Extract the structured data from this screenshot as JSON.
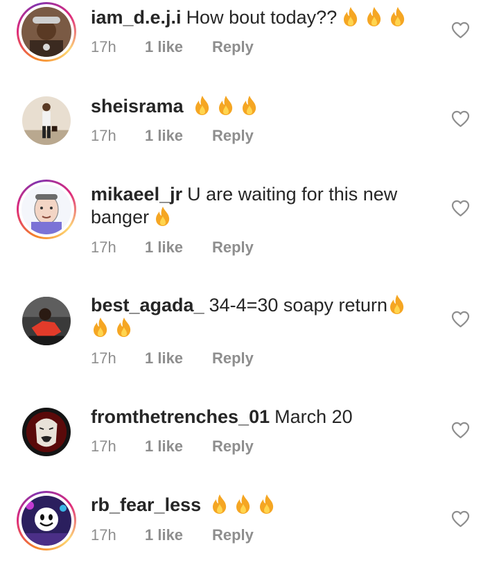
{
  "comments": [
    {
      "username": "iam_d.e.j.i",
      "text": "How bout today??",
      "fire_after_text": 3,
      "fire_line2": 0,
      "time": "17h",
      "likes": "1 like",
      "reply": "Reply",
      "has_story": true,
      "avatar_icon": "avatar-person-hat"
    },
    {
      "username": "sheisrama",
      "text": "",
      "fire_after_text": 3,
      "fire_line2": 0,
      "time": "17h",
      "likes": "1 like",
      "reply": "Reply",
      "has_story": false,
      "avatar_icon": "avatar-person-standing"
    },
    {
      "username": "mikaeel_jr",
      "text": "U are waiting for this new",
      "text_line2": "banger",
      "fire_after_text": 0,
      "fire_line2": 1,
      "time": "17h",
      "likes": "1 like",
      "reply": "Reply",
      "has_story": true,
      "avatar_icon": "avatar-cartoon-face"
    },
    {
      "username": "best_agada_",
      "text": "34-4=30 soapy return",
      "fire_after_text": 1,
      "fire_line2": 2,
      "time": "17h",
      "likes": "1 like",
      "reply": "Reply",
      "has_story": false,
      "avatar_icon": "avatar-person-red"
    },
    {
      "username": "fromthetrenches_01",
      "text": "March 20",
      "fire_after_text": 0,
      "fire_line2": 0,
      "time": "17h",
      "likes": "1 like",
      "reply": "Reply",
      "has_story": false,
      "avatar_icon": "avatar-mask"
    },
    {
      "username": "rb_fear_less",
      "text": "",
      "fire_after_text": 3,
      "fire_line2": 0,
      "time": "17h",
      "likes": "1 like",
      "reply": "Reply",
      "has_story": true,
      "avatar_icon": "avatar-marshmello"
    }
  ],
  "icons": {
    "fire": "fire-emoji-icon",
    "like": "heart-outline-icon"
  },
  "colors": {
    "text": "#262626",
    "meta": "#8e8e8e",
    "fire_outer": "#f5a623",
    "fire_inner": "#ffd54f"
  }
}
